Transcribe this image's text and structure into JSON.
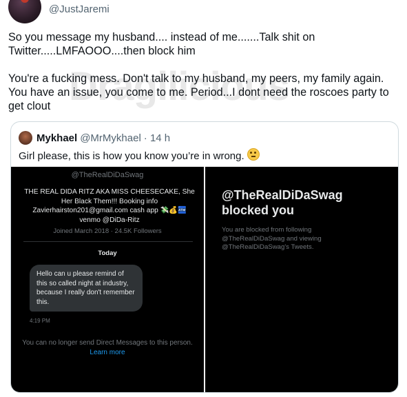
{
  "tweet": {
    "handle": "@JustJaremi",
    "paragraph1": "So you message my husband.... instead of me.......Talk shit on Twitter.....LMFAOOO....then block him",
    "paragraph2": "You're a fucking mess. Don't talk to my husband, my peers, my family again. You have an issue, you come to me. Period...I dont need the roscoes party to get clout"
  },
  "watermark": "Dragilicious",
  "quote": {
    "name": "Mykhael",
    "handle": "@MrMykhael",
    "time": "· 14 h",
    "text": "Girl please, this is how you know you’re in wrong.",
    "emoji": "rolling-eyes-emoji"
  },
  "screenshot_left": {
    "handle": "@TheRealDiDaSwag",
    "bio": "THE REAL DIDA RITZ AKA MISS CHEESECAKE, She Her Black Them!!! Booking info Zavierhairston201@gmail.com cash app 💸💰🏧 venmo @DiDa-Ritz",
    "joined": "Joined March 2018 · 24.5K Followers",
    "today": "Today",
    "message": "Hello can u please remind of this so called night at industry, because I really don't remember this.",
    "time": "4:19 PM",
    "notice": "You can no longer send Direct Messages to this person.",
    "learn_more": "Learn more"
  },
  "screenshot_right": {
    "title": "@TheRealDiDaSwag blocked you",
    "description": "You are blocked from following @TheRealDiDaSwag and viewing @TheRealDiDaSwag's Tweets."
  }
}
